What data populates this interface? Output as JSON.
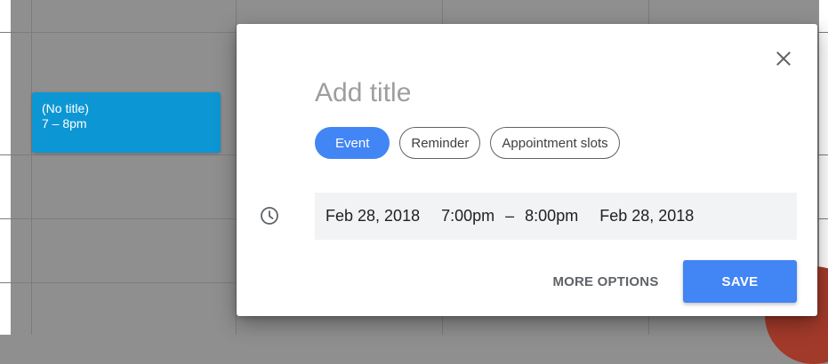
{
  "calendar": {
    "event_chip": {
      "title": "(No title)",
      "time": "7 – 8pm"
    }
  },
  "dialog": {
    "close_icon": "close-icon",
    "title_placeholder": "Add title",
    "type_tabs": [
      {
        "label": "Event",
        "selected": true
      },
      {
        "label": "Reminder",
        "selected": false
      },
      {
        "label": "Appointment slots",
        "selected": false
      }
    ],
    "datetime": {
      "icon": "clock-icon",
      "start_date": "Feb 28, 2018",
      "start_time": "7:00pm",
      "separator": "–",
      "end_time": "8:00pm",
      "end_date": "Feb 28, 2018"
    },
    "more_options_label": "MORE OPTIONS",
    "save_label": "SAVE"
  },
  "colors": {
    "accent": "#4285f4",
    "event_chip": "#0d96d4",
    "overlay_dim": "#8f8f8f",
    "fab_behind": "#a23a2a"
  }
}
